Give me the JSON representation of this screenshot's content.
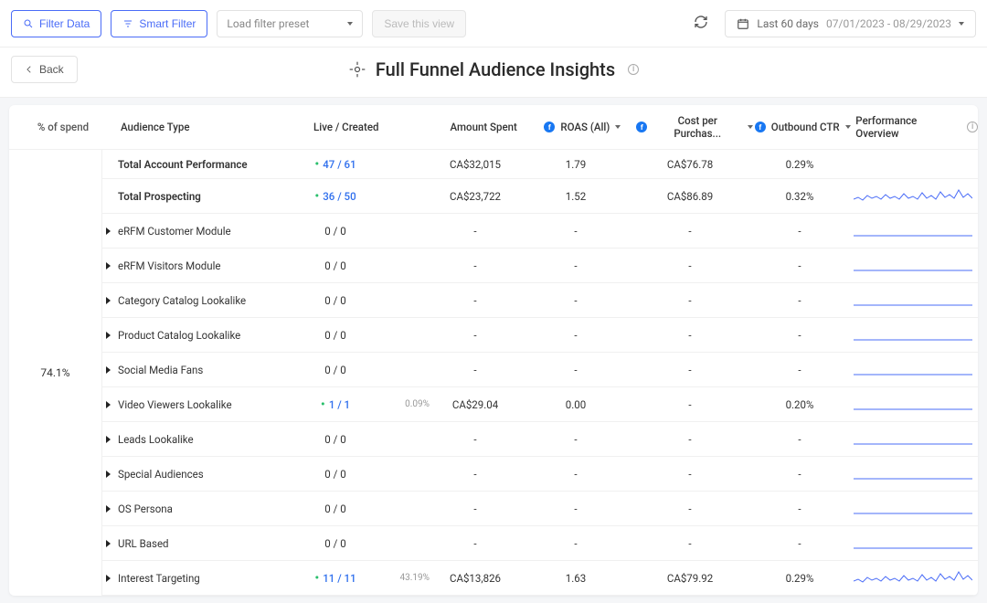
{
  "toolbar": {
    "filter_data": "Filter Data",
    "smart_filter": "Smart Filter",
    "preset_placeholder": "Load filter preset",
    "save_view": "Save this view",
    "date_label": "Last 60 days",
    "date_range": "07/01/2023 - 08/29/2023"
  },
  "back": "Back",
  "page_title": "Full Funnel Audience Insights",
  "columns": {
    "spend": "% of spend",
    "audience": "Audience Type",
    "live": "Live / Created",
    "amount": "Amount Spent",
    "roas": "ROAS (All)",
    "cpp": "Cost per Purchas...",
    "ctr": "Outbound CTR",
    "perf": "Performance Overview"
  },
  "spend_group": "74.1%",
  "rows": [
    {
      "label": "Total Account Performance",
      "bold": true,
      "caret": false,
      "live": "47 / 61",
      "live_blue": true,
      "pct": "",
      "amount": "CA$32,015",
      "roas": "1.79",
      "cpp": "CA$76.78",
      "ctr": "0.29%",
      "spark": "none"
    },
    {
      "label": "Total Prospecting",
      "bold": true,
      "caret": false,
      "live": "36 / 50",
      "live_blue": true,
      "pct": "",
      "amount": "CA$23,722",
      "roas": "1.52",
      "cpp": "CA$86.89",
      "ctr": "0.32%",
      "spark": "wavy"
    },
    {
      "label": "eRFM Customer Module",
      "caret": true,
      "live": "0 / 0",
      "pct": "",
      "amount": "-",
      "roas": "-",
      "cpp": "-",
      "ctr": "-",
      "spark": "flat"
    },
    {
      "label": "eRFM Visitors Module",
      "caret": true,
      "live": "0 / 0",
      "pct": "",
      "amount": "-",
      "roas": "-",
      "cpp": "-",
      "ctr": "-",
      "spark": "flat"
    },
    {
      "label": "Category Catalog Lookalike",
      "caret": true,
      "live": "0 / 0",
      "pct": "",
      "amount": "-",
      "roas": "-",
      "cpp": "-",
      "ctr": "-",
      "spark": "flat"
    },
    {
      "label": "Product Catalog Lookalike",
      "caret": true,
      "live": "0 / 0",
      "pct": "",
      "amount": "-",
      "roas": "-",
      "cpp": "-",
      "ctr": "-",
      "spark": "flat"
    },
    {
      "label": "Social Media Fans",
      "caret": true,
      "live": "0 / 0",
      "pct": "",
      "amount": "-",
      "roas": "-",
      "cpp": "-",
      "ctr": "-",
      "spark": "flat"
    },
    {
      "label": "Video Viewers Lookalike",
      "caret": true,
      "live": "1 / 1",
      "live_blue": true,
      "pct": "0.09%",
      "amount": "CA$29.04",
      "roas": "0.00",
      "cpp": "-",
      "ctr": "0.20%",
      "spark": "flat"
    },
    {
      "label": "Leads Lookalike",
      "caret": true,
      "live": "0 / 0",
      "pct": "",
      "amount": "-",
      "roas": "-",
      "cpp": "-",
      "ctr": "-",
      "spark": "flat"
    },
    {
      "label": "Special Audiences",
      "caret": true,
      "live": "0 / 0",
      "pct": "",
      "amount": "-",
      "roas": "-",
      "cpp": "-",
      "ctr": "-",
      "spark": "flat"
    },
    {
      "label": "OS Persona",
      "caret": true,
      "live": "0 / 0",
      "pct": "",
      "amount": "-",
      "roas": "-",
      "cpp": "-",
      "ctr": "-",
      "spark": "flat"
    },
    {
      "label": "URL Based",
      "caret": true,
      "live": "0 / 0",
      "pct": "",
      "amount": "-",
      "roas": "-",
      "cpp": "-",
      "ctr": "-",
      "spark": "flat"
    },
    {
      "label": "Interest Targeting",
      "caret": true,
      "live": "11 / 11",
      "live_blue": true,
      "pct": "43.19%",
      "amount": "CA$13,826",
      "roas": "1.63",
      "cpp": "CA$79.92",
      "ctr": "0.29%",
      "spark": "wavy"
    }
  ]
}
